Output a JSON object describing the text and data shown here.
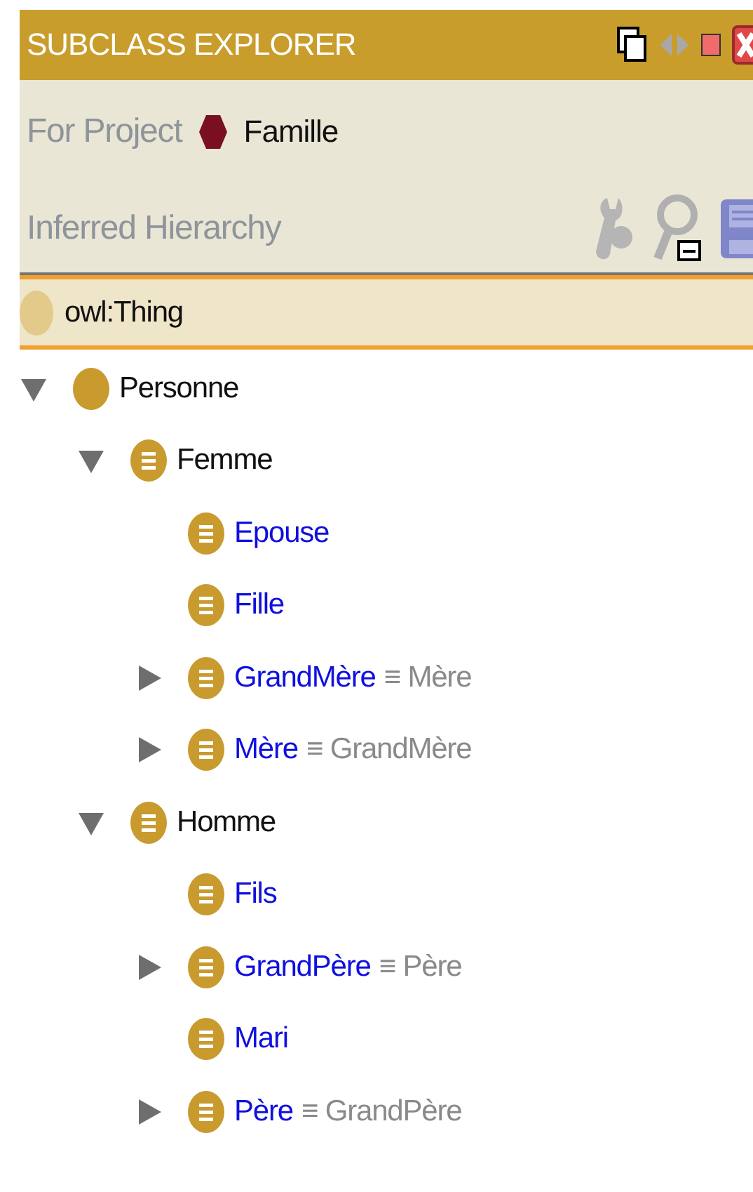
{
  "panel": {
    "title": "SUBCLASS EXPLORER"
  },
  "project": {
    "label": "For Project",
    "name": "Famille"
  },
  "hierarchy": {
    "label": "Inferred Hierarchy"
  },
  "root": {
    "label": "owl:Thing"
  },
  "tree": [
    {
      "label": "Personne",
      "kind": "primitive",
      "inferred": false,
      "expanded": true,
      "children": [
        {
          "label": "Femme",
          "kind": "defined",
          "inferred": false,
          "expanded": true,
          "children": [
            {
              "label": "Epouse",
              "kind": "defined",
              "inferred": true
            },
            {
              "label": "Fille",
              "kind": "defined",
              "inferred": true
            },
            {
              "label": "GrandMère",
              "kind": "defined",
              "inferred": true,
              "expanded": false,
              "equivalent": "≡ Mère"
            },
            {
              "label": "Mère",
              "kind": "defined",
              "inferred": true,
              "expanded": false,
              "equivalent": "≡ GrandMère"
            }
          ]
        },
        {
          "label": "Homme",
          "kind": "defined",
          "inferred": false,
          "expanded": true,
          "children": [
            {
              "label": "Fils",
              "kind": "defined",
              "inferred": true
            },
            {
              "label": "GrandPère",
              "kind": "defined",
              "inferred": true,
              "expanded": false,
              "equivalent": "≡ Père"
            },
            {
              "label": "Mari",
              "kind": "defined",
              "inferred": true
            },
            {
              "label": "Père",
              "kind": "defined",
              "inferred": true,
              "expanded": false,
              "equivalent": "≡ GrandPère"
            }
          ]
        }
      ]
    }
  ]
}
